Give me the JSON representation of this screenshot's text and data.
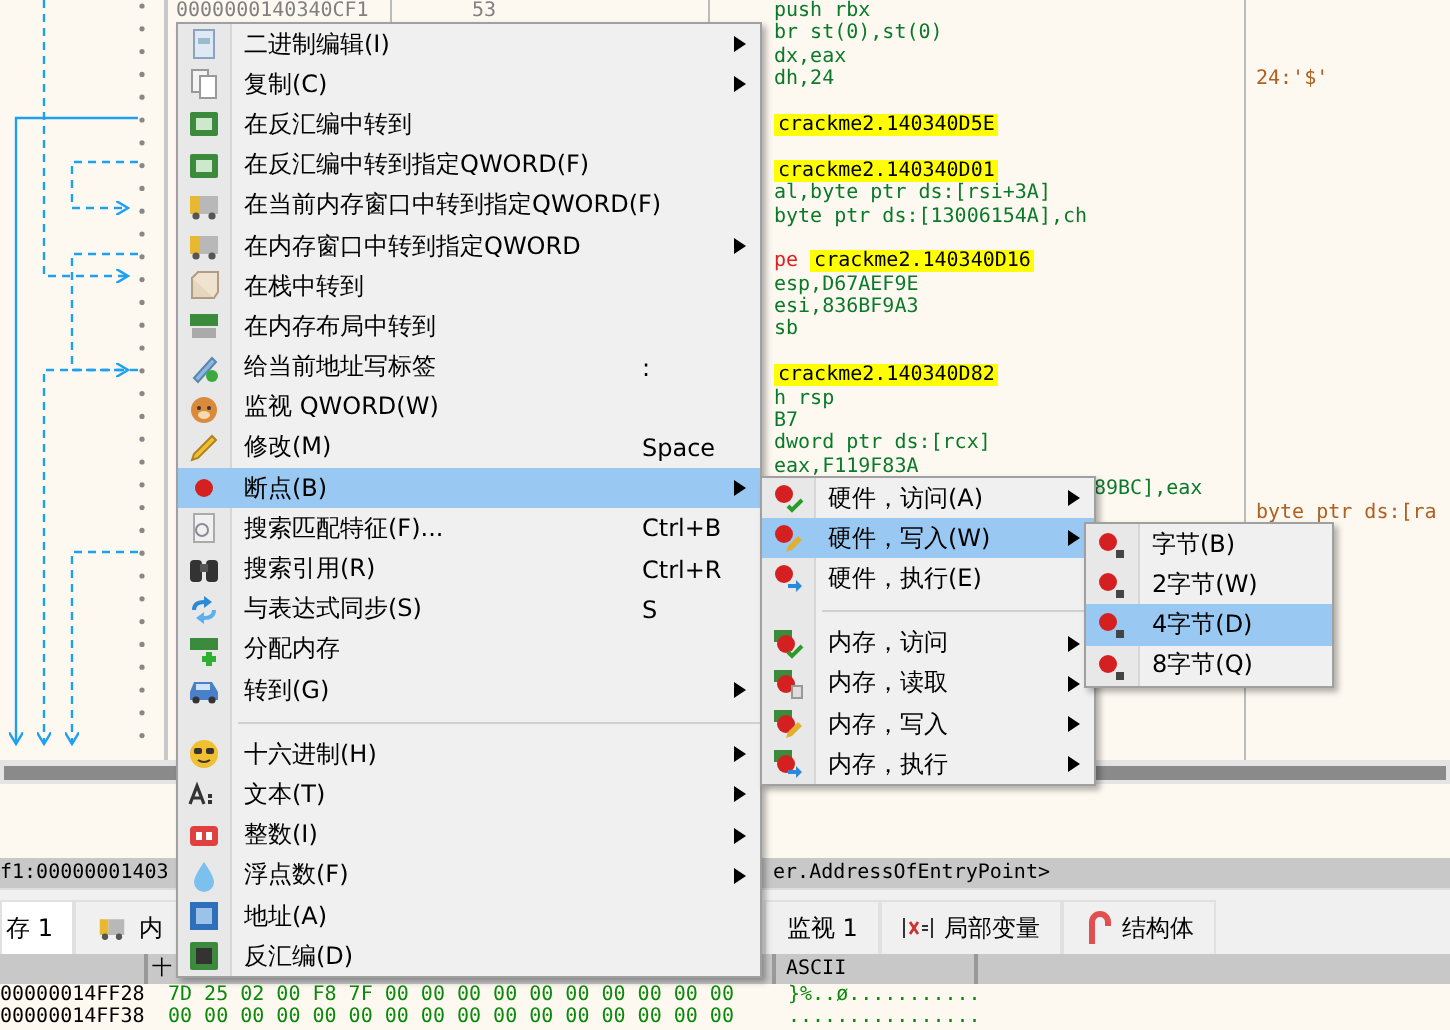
{
  "disassembly": {
    "address": "0000000140340CF1",
    "bytes": "53",
    "lines": [
      {
        "kind": "code",
        "text": "push rbx"
      },
      {
        "kind": "code",
        "text": "br st(0),st(0)"
      },
      {
        "kind": "code",
        "text": "dx,eax"
      },
      {
        "kind": "code",
        "text": "dh,24",
        "comment": "24:'$'"
      },
      {
        "kind": "blank"
      },
      {
        "kind": "jump",
        "text": "crackme2.140340D5E"
      },
      {
        "kind": "blank"
      },
      {
        "kind": "jump",
        "text": "crackme2.140340D01"
      },
      {
        "kind": "code",
        "text": "al,byte ptr ds:[rsi+3A]"
      },
      {
        "kind": "code",
        "text": "byte ptr ds:[13006154A],ch"
      },
      {
        "kind": "blank"
      },
      {
        "kind": "jump",
        "prefix": "pe",
        "text": "crackme2.140340D16"
      },
      {
        "kind": "code",
        "text": "esp,D67AEF9E"
      },
      {
        "kind": "code",
        "text": "esi,836BF9A3"
      },
      {
        "kind": "code",
        "text": "sb"
      },
      {
        "kind": "blank"
      },
      {
        "kind": "jump",
        "text": "crackme2.140340D82"
      },
      {
        "kind": "code",
        "text": "h rsp"
      },
      {
        "kind": "code",
        "text": "B7"
      },
      {
        "kind": "code",
        "text": "dword ptr ds:[rcx]"
      },
      {
        "kind": "code",
        "text": "eax,F119F83A"
      },
      {
        "kind": "tail",
        "text": "89BC],eax"
      },
      {
        "kind": "blank",
        "comment": "byte ptr ds:[ra"
      }
    ]
  },
  "context_menu": {
    "items": [
      {
        "kind": "item",
        "label": "二进制编辑(I)",
        "submenu": true,
        "selected": false
      },
      {
        "kind": "item",
        "label": "复制(C)",
        "submenu": true,
        "selected": false
      },
      {
        "kind": "item",
        "label": "在反汇编中转到",
        "submenu": false,
        "selected": false
      },
      {
        "kind": "item",
        "label": "在反汇编中转到指定QWORD(F)",
        "submenu": false,
        "selected": false
      },
      {
        "kind": "item",
        "label": "在当前内存窗口中转到指定QWORD(F)",
        "submenu": false,
        "selected": false
      },
      {
        "kind": "item",
        "label": "在内存窗口中转到指定QWORD",
        "submenu": true,
        "selected": false
      },
      {
        "kind": "item",
        "label": "在栈中转到",
        "submenu": false,
        "selected": false
      },
      {
        "kind": "item",
        "label": "在内存布局中转到",
        "submenu": false,
        "selected": false
      },
      {
        "kind": "item",
        "label": "给当前地址写标签",
        "shortcut": ":",
        "submenu": false,
        "selected": false
      },
      {
        "kind": "item",
        "label": "监视 QWORD(W)",
        "submenu": false,
        "selected": false
      },
      {
        "kind": "item",
        "label": "修改(M)",
        "shortcut": "Space",
        "submenu": false,
        "selected": false
      },
      {
        "kind": "item",
        "label": "断点(B)",
        "submenu": true,
        "selected": true
      },
      {
        "kind": "item",
        "label": "搜索匹配特征(F)...",
        "shortcut": "Ctrl+B",
        "submenu": false,
        "selected": false
      },
      {
        "kind": "item",
        "label": "搜索引用(R)",
        "shortcut": "Ctrl+R",
        "submenu": false,
        "selected": false
      },
      {
        "kind": "item",
        "label": "与表达式同步(S)",
        "shortcut": "S",
        "submenu": false,
        "selected": false
      },
      {
        "kind": "item",
        "label": "分配内存",
        "submenu": false,
        "selected": false
      },
      {
        "kind": "item",
        "label": "转到(G)",
        "submenu": true,
        "selected": false
      },
      {
        "kind": "separator"
      },
      {
        "kind": "item",
        "label": "十六进制(H)",
        "submenu": true,
        "selected": false
      },
      {
        "kind": "item",
        "label": "文本(T)",
        "submenu": true,
        "selected": false
      },
      {
        "kind": "item",
        "label": "整数(I)",
        "submenu": true,
        "selected": false
      },
      {
        "kind": "item",
        "label": "浮点数(F)",
        "submenu": true,
        "selected": false
      },
      {
        "kind": "item",
        "label": "地址(A)",
        "submenu": false,
        "selected": false
      },
      {
        "kind": "item",
        "label": "反汇编(D)",
        "submenu": false,
        "selected": false
      }
    ]
  },
  "breakpoint_submenu": {
    "items": [
      {
        "kind": "item",
        "label": "硬件，访问(A)",
        "submenu": true,
        "selected": false
      },
      {
        "kind": "item",
        "label": "硬件，写入(W)",
        "submenu": true,
        "selected": true
      },
      {
        "kind": "item",
        "label": "硬件，执行(E)",
        "submenu": false,
        "selected": false
      },
      {
        "kind": "separator"
      },
      {
        "kind": "item",
        "label": "内存，访问",
        "submenu": true,
        "selected": false
      },
      {
        "kind": "item",
        "label": "内存，读取",
        "submenu": true,
        "selected": false
      },
      {
        "kind": "item",
        "label": "内存，写入",
        "submenu": true,
        "selected": false
      },
      {
        "kind": "item",
        "label": "内存，执行",
        "submenu": true,
        "selected": false
      }
    ]
  },
  "hardware_write_submenu": {
    "items": [
      {
        "kind": "item",
        "label": "字节(B)",
        "submenu": false,
        "selected": false
      },
      {
        "kind": "item",
        "label": "2字节(W)",
        "submenu": false,
        "selected": false
      },
      {
        "kind": "item",
        "label": "4字节(D)",
        "submenu": false,
        "selected": true
      },
      {
        "kind": "item",
        "label": "8字节(Q)",
        "submenu": false,
        "selected": false
      }
    ]
  },
  "status_bar": {
    "left_text": "f1:00000001403",
    "right_text": "er.AddressOfEntryPoint>"
  },
  "bottom_tabs": [
    {
      "label": "存 1",
      "selected": true
    },
    {
      "label": "内",
      "selected": false
    },
    {
      "label": "监视 1",
      "selected": false
    },
    {
      "label": "局部变量",
      "selected": false
    },
    {
      "label": "结构体",
      "selected": false
    }
  ],
  "dump": {
    "columns": [
      "十",
      "ASCII"
    ],
    "rows": [
      {
        "address": "00000014FF28",
        "hex": "7D 25 02 00 F8 7F 00 00 00 00 00 00 00 00 00 00",
        "ascii": "}%..ø..........."
      },
      {
        "address": "00000014FF38",
        "hex": "00 00 00 00 00 00 00 00 00 00 00 00 00 00 00 00",
        "ascii": "................"
      }
    ]
  }
}
